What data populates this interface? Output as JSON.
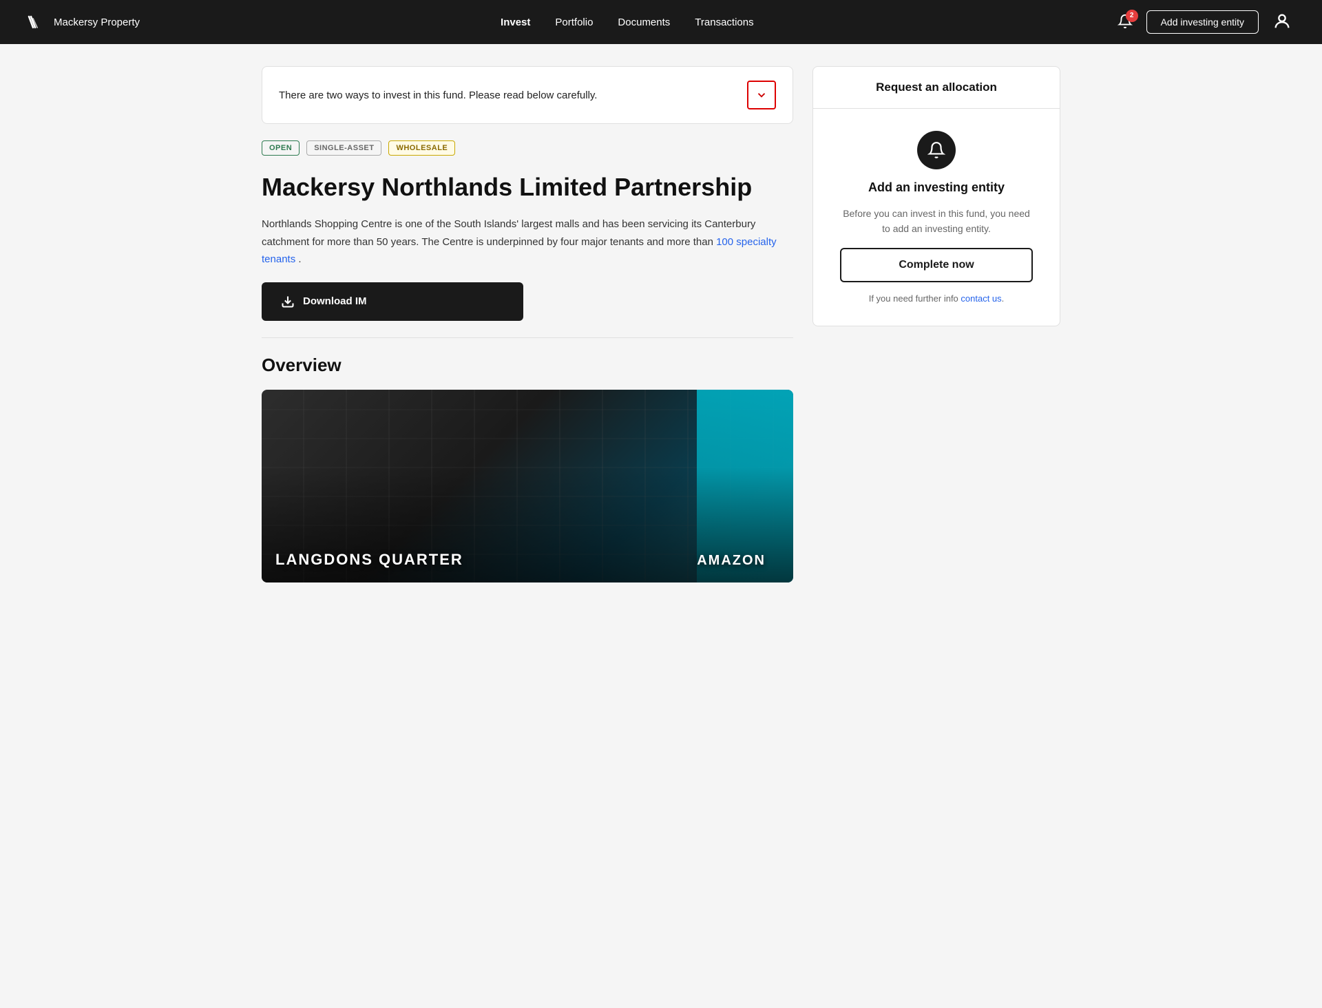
{
  "nav": {
    "logo": "Mackersy Property",
    "links": [
      {
        "label": "Invest",
        "active": true
      },
      {
        "label": "Portfolio",
        "active": false
      },
      {
        "label": "Documents",
        "active": false
      },
      {
        "label": "Transactions",
        "active": false
      }
    ],
    "notification_count": "2",
    "add_entity_btn": "Add investing entity"
  },
  "banner": {
    "text": "There are two ways to invest in this fund. Please read below carefully."
  },
  "tags": [
    {
      "label": "OPEN",
      "type": "open"
    },
    {
      "label": "SINGLE-ASSET",
      "type": "single"
    },
    {
      "label": "WHOLESALE",
      "type": "wholesale"
    }
  ],
  "fund": {
    "title": "Mackersy Northlands Limited Partnership",
    "description": "Northlands Shopping Centre is one of the South Islands' largest malls and has been servicing its Canterbury catchment for more than 50 years. The Centre is underpinned by four major tenants and more than",
    "highlight_text": "100 specialty tenants",
    "description_end": "."
  },
  "download_btn": "Download IM",
  "overview": {
    "title": "Overview",
    "image_label": "LANGDONS QUARTER",
    "image_label_sub": "AMAZON"
  },
  "allocation": {
    "header": "Request an allocation",
    "entity_title": "Add an investing entity",
    "entity_desc": "Before you can invest in this fund, you need to add an investing entity.",
    "complete_btn": "Complete now",
    "contact_prefix": "If you need further info ",
    "contact_link": "contact us",
    "contact_suffix": "."
  }
}
